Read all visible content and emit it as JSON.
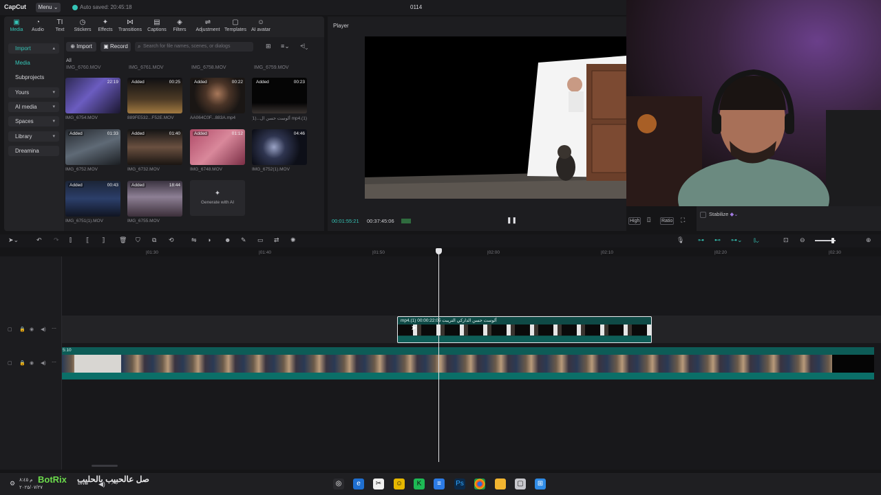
{
  "titlebar": {
    "logo": "CapCut",
    "menu_label": "Menu ⌄",
    "autosave": "Auto saved: 20:45:18",
    "project_title": "0114"
  },
  "toolbar_tabs": [
    {
      "label": "Media",
      "icon": "media-icon",
      "glyph": "▣"
    },
    {
      "label": "Audio",
      "icon": "audio-icon",
      "glyph": "◔"
    },
    {
      "label": "Text",
      "icon": "text-icon",
      "glyph": "TI"
    },
    {
      "label": "Stickers",
      "icon": "stickers-icon",
      "glyph": "◷"
    },
    {
      "label": "Effects",
      "icon": "effects-icon",
      "glyph": "✦"
    },
    {
      "label": "Transitions",
      "icon": "transitions-icon",
      "glyph": "⋈"
    },
    {
      "label": "Captions",
      "icon": "captions-icon",
      "glyph": "▤"
    },
    {
      "label": "Filters",
      "icon": "filters-icon",
      "glyph": "◈"
    },
    {
      "label": "Adjustment",
      "icon": "adjustment-icon",
      "glyph": "⇌"
    },
    {
      "label": "Templates",
      "icon": "templates-icon",
      "glyph": "▢"
    },
    {
      "label": "AI avatar",
      "icon": "ai-avatar-icon",
      "glyph": "☺"
    }
  ],
  "sidebar": {
    "import": "Import",
    "media": "Media",
    "subprojects": "Subprojects",
    "yours": "Yours",
    "ai_media": "AI media",
    "spaces": "Spaces",
    "library": "Library",
    "dreamina": "Dreamina"
  },
  "media_toolbar": {
    "import": "Import",
    "record": "Record",
    "search_placeholder": "Search for file names, scenes, or dialogs",
    "all": "All"
  },
  "top_names": [
    "IMG_6760.MOV",
    "IMG_6761.MOV",
    "IMG_6758.MOV",
    "IMG_6759.MOV"
  ],
  "media_items": [
    {
      "name": "IMG_6754.MOV",
      "badge": "",
      "dur": "22:19"
    },
    {
      "name": "889FE532...F52E.MOV",
      "badge": "Added",
      "dur": "00:25"
    },
    {
      "name": "AA064C0F...883A.mp4",
      "badge": "Added",
      "dur": "00:22"
    },
    {
      "name": "mp4.(1) ألوست حسن ال...(1)",
      "badge": "Added",
      "dur": "00:23"
    },
    {
      "name": "IMG_6752.MOV",
      "badge": "Added",
      "dur": "01:33"
    },
    {
      "name": "IMG_6732.MOV",
      "badge": "Added",
      "dur": "01:40"
    },
    {
      "name": "IMG_6748.MOV",
      "badge": "Added",
      "dur": "01:12"
    },
    {
      "name": "IMG_6752(1).MOV",
      "badge": "",
      "dur": "04:46"
    },
    {
      "name": "IMG_6751(1).MOV",
      "badge": "Added",
      "dur": "00:43"
    },
    {
      "name": "IMG_6755.MOV",
      "badge": "Added",
      "dur": "18:44"
    }
  ],
  "generate_ai": "Generate with AI",
  "player": {
    "title": "Player",
    "time_current": "00:01:55:21",
    "time_total": "00:37:45:06",
    "quality": "High",
    "ratio": "Ratio"
  },
  "details": {
    "stabilize": "Stabilize"
  },
  "timeline": {
    "ticks": [
      "|01:30",
      "|01:40",
      "|01:50",
      "|02:00",
      "|02:10",
      "|02:20",
      "|02:30"
    ],
    "overlay_clip_label": "mp4.(1) ألوست حسن الداركي التريبت  00:00:22:05",
    "main_clip_label": "5:10"
  },
  "taskbar": {
    "arabic_overlay": "صل عالحبيب بالحليب",
    "botrix": "BotRix",
    "tray_lang": "ENG",
    "tray_time": "م ٨:٤٥",
    "tray_date": "٢٠٢٥/٠٧/٢٧"
  }
}
